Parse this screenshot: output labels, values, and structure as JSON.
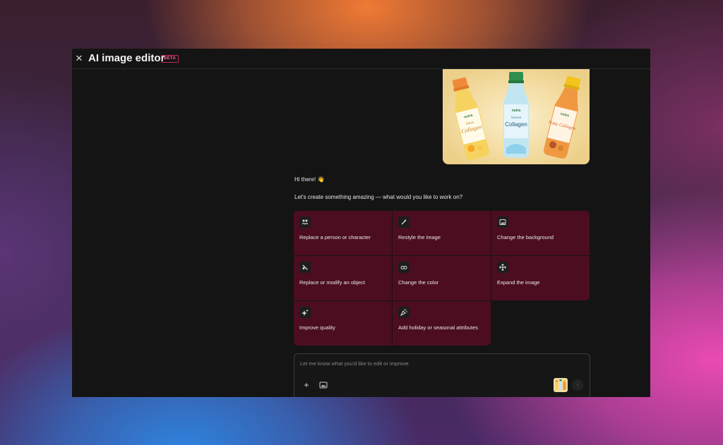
{
  "window": {
    "title": "AI image editor",
    "badge": "BETA",
    "close_icon": "close-icon"
  },
  "preview": {
    "bottles": [
      {
        "brand": "nutra",
        "name": "Collagen",
        "flavor": "Citrus",
        "cap_color": "#f08a3a",
        "liquid": "#f6d25a"
      },
      {
        "brand": "nutra",
        "name": "Collagen",
        "flavor": "Natural",
        "cap_color": "#2f8f4e",
        "liquid": "#bfe6f4"
      },
      {
        "brand": "nutra",
        "name": "Nutty Collagen",
        "flavor": "",
        "cap_color": "#f2c41c",
        "liquid": "#f0923a"
      }
    ]
  },
  "chat": {
    "greeting": "Hi there! 👋",
    "prompt": "Let's create something amazing — what would you like to work on?"
  },
  "options": [
    {
      "label": "Replace a person or character",
      "icon": "person-swap-icon"
    },
    {
      "label": "Restyle the image",
      "icon": "magic-wand-icon"
    },
    {
      "label": "Change the background",
      "icon": "image-icon"
    },
    {
      "label": "Replace or modify an object",
      "icon": "object-edit-icon"
    },
    {
      "label": "Change the color",
      "icon": "glasses-icon"
    },
    {
      "label": "Expand the image",
      "icon": "expand-arrows-icon"
    },
    {
      "label": "Improve quality",
      "icon": "sparkle-icon"
    },
    {
      "label": "Add holiday or seasonal attributes",
      "icon": "confetti-icon"
    }
  ],
  "composer": {
    "placeholder": "Let me know what you'd like to edit or improve.",
    "add_icon": "plus-icon",
    "image_icon": "image-upload-icon",
    "send_icon": "arrow-up-icon"
  },
  "colors": {
    "option_background": "#4b0d1f",
    "window_background": "#141414",
    "badge_color": "#ff5d8f"
  }
}
